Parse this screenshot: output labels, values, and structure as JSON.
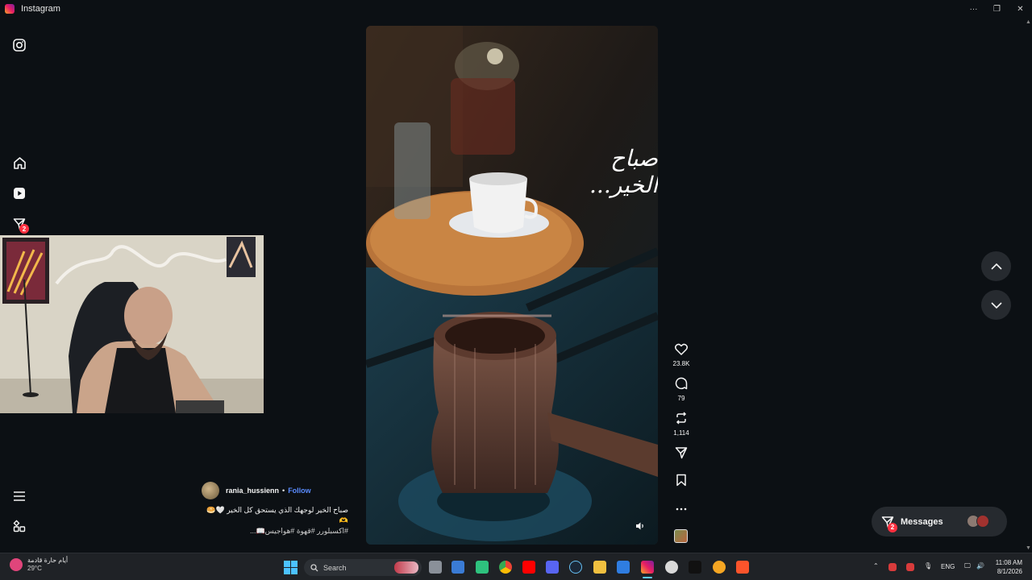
{
  "window": {
    "title": "Instagram",
    "controls": [
      "···",
      "❐",
      "✕"
    ]
  },
  "left_nav": {
    "items": [
      {
        "name": "instagram-logo-icon"
      },
      {
        "name": "home-icon"
      },
      {
        "name": "reels-icon"
      },
      {
        "name": "messenger-icon",
        "badge": "2"
      },
      {
        "name": "menu-icon"
      },
      {
        "name": "also-from-meta-icon"
      }
    ]
  },
  "reel": {
    "overlay_text": "صباح الخير...",
    "author": {
      "username": "rania_hussienn",
      "separator": "•",
      "follow_label": "Follow"
    },
    "caption_line1": "صباح الخير لوجهك الذي يستحق كل الخير 🤍🥯",
    "caption_line2": "🫶",
    "caption_line3": "#اكسبلورر #قهوة #هواجيس📖...",
    "actions": {
      "likes": "23.8K",
      "comments": "79",
      "reposts": "1,114"
    }
  },
  "messages": {
    "label": "Messages",
    "badge": "2"
  },
  "taskbar": {
    "weather_title": "أيام حارة قادمة",
    "weather_temp": "29°C",
    "search_placeholder": "Search",
    "language": "ENG",
    "time": "11:08 AM",
    "date": "8/1/2026"
  },
  "colors": {
    "background": "#0c1014",
    "follow": "#5a8cff",
    "badge": "#ff3040",
    "pill": "#262a2f"
  }
}
